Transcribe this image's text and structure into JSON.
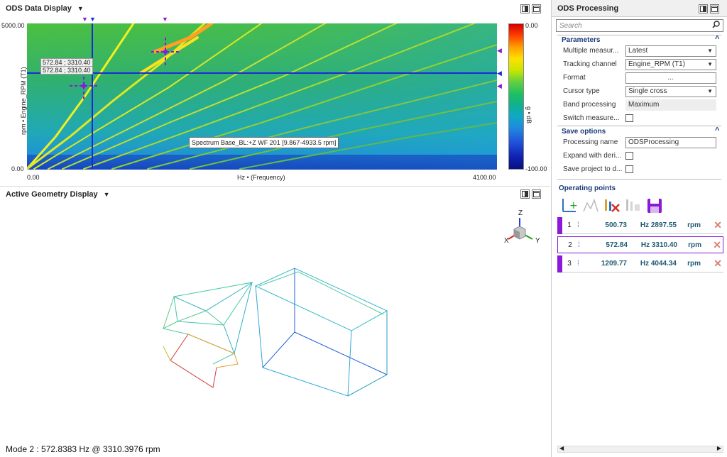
{
  "ods_data_display": {
    "title": "ODS Data Display",
    "y_axis_label": "rpm • Engine_RPM (T1)",
    "x_axis_label": "Hz • (Frequency)",
    "y_ticks": [
      "5000.00",
      "0.00"
    ],
    "x_ticks": [
      "0.00",
      "4100.00"
    ],
    "colorbar_label": "g • dB",
    "colorbar_ticks": [
      "0.00",
      "-100.00"
    ],
    "cursor_labels": [
      "572.84 ; 3310.40",
      "572.84 ; 3310.40"
    ],
    "tooltip": "Spectrum Base_BL:+Z WF 201 [9.867-4933.5 rpm]"
  },
  "active_geometry": {
    "title": "Active Geometry Display",
    "axis_z": "Z",
    "axis_x": "X",
    "axis_y": "Y"
  },
  "status": {
    "mode_text": "Mode  2 : 572.8383 Hz @ 3310.3976 rpm"
  },
  "ods_processing": {
    "title": "ODS Processing",
    "search_placeholder": "Search",
    "parameters_title": "Parameters",
    "params": [
      {
        "label": "Multiple measur...",
        "value": "Latest",
        "type": "select"
      },
      {
        "label": "Tracking channel",
        "value": "Engine_RPM (T1)",
        "type": "select"
      },
      {
        "label": "Format",
        "value": "...",
        "type": "button"
      },
      {
        "label": "Cursor type",
        "value": "Single cross",
        "type": "select"
      },
      {
        "label": "Band processing",
        "value": "Maximum",
        "type": "readonly"
      },
      {
        "label": "Switch measure...",
        "value": "",
        "type": "checkbox"
      }
    ],
    "save_title": "Save options",
    "save_options": [
      {
        "label": "Processing name",
        "value": "ODSProcessing",
        "type": "text"
      },
      {
        "label": "Expand with deri...",
        "value": "",
        "type": "checkbox"
      },
      {
        "label": "Save project to d...",
        "value": "",
        "type": "checkbox"
      }
    ],
    "operating_points_title": "Operating points",
    "operating_points": [
      {
        "num": "1",
        "freq": "500.73",
        "rpm": "Hz 2897.55",
        "unit": "rpm"
      },
      {
        "num": "2",
        "freq": "572.84",
        "rpm": "Hz 3310.40",
        "unit": "rpm"
      },
      {
        "num": "3",
        "freq": "1209.77",
        "rpm": "Hz 4044.34",
        "unit": "rpm"
      }
    ]
  },
  "colors": {
    "accent_purple": "#8a1ad8",
    "cursor_blue": "#1a2ad8",
    "section_blue": "#1a3a7a"
  }
}
